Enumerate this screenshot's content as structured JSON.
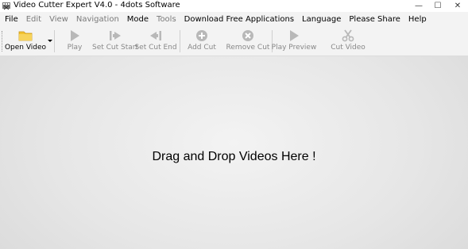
{
  "window": {
    "title": "Video Cutter Expert V4.0 - 4dots Software",
    "minimize_glyph": "—",
    "maximize_glyph": "☐",
    "close_glyph": "✕"
  },
  "menu": {
    "items": [
      {
        "label": "File",
        "enabled": true
      },
      {
        "label": "Edit",
        "enabled": false
      },
      {
        "label": "View",
        "enabled": false
      },
      {
        "label": "Navigation",
        "enabled": false
      },
      {
        "label": "Mode",
        "enabled": true
      },
      {
        "label": "Tools",
        "enabled": false
      },
      {
        "label": "Download Free Applications",
        "enabled": true
      },
      {
        "label": "Language",
        "enabled": true
      },
      {
        "label": "Please Share",
        "enabled": true
      },
      {
        "label": "Help",
        "enabled": true
      }
    ]
  },
  "toolbar": {
    "open_video": {
      "label": "Open Video",
      "icon": "folder-icon",
      "enabled": true
    },
    "play": {
      "label": "Play",
      "icon": "play-icon",
      "enabled": false
    },
    "set_cut_start": {
      "label": "Set Cut Start",
      "icon": "cut-start-icon",
      "enabled": false
    },
    "set_cut_end": {
      "label": "Set Cut End",
      "icon": "cut-end-icon",
      "enabled": false
    },
    "add_cut": {
      "label": "Add Cut",
      "icon": "plus-circle-icon",
      "enabled": false
    },
    "remove_cut": {
      "label": "Remove Cut",
      "icon": "x-circle-icon",
      "enabled": false
    },
    "play_preview": {
      "label": "Play Preview",
      "icon": "play-preview-icon",
      "enabled": false
    },
    "cut_video": {
      "label": "Cut Video",
      "icon": "scissors-icon",
      "enabled": false
    }
  },
  "drop_area": {
    "text": "Drag and Drop Videos Here !"
  },
  "colors": {
    "icon_disabled": "#b8b8b8",
    "folder_yellow": "#f2c230"
  }
}
